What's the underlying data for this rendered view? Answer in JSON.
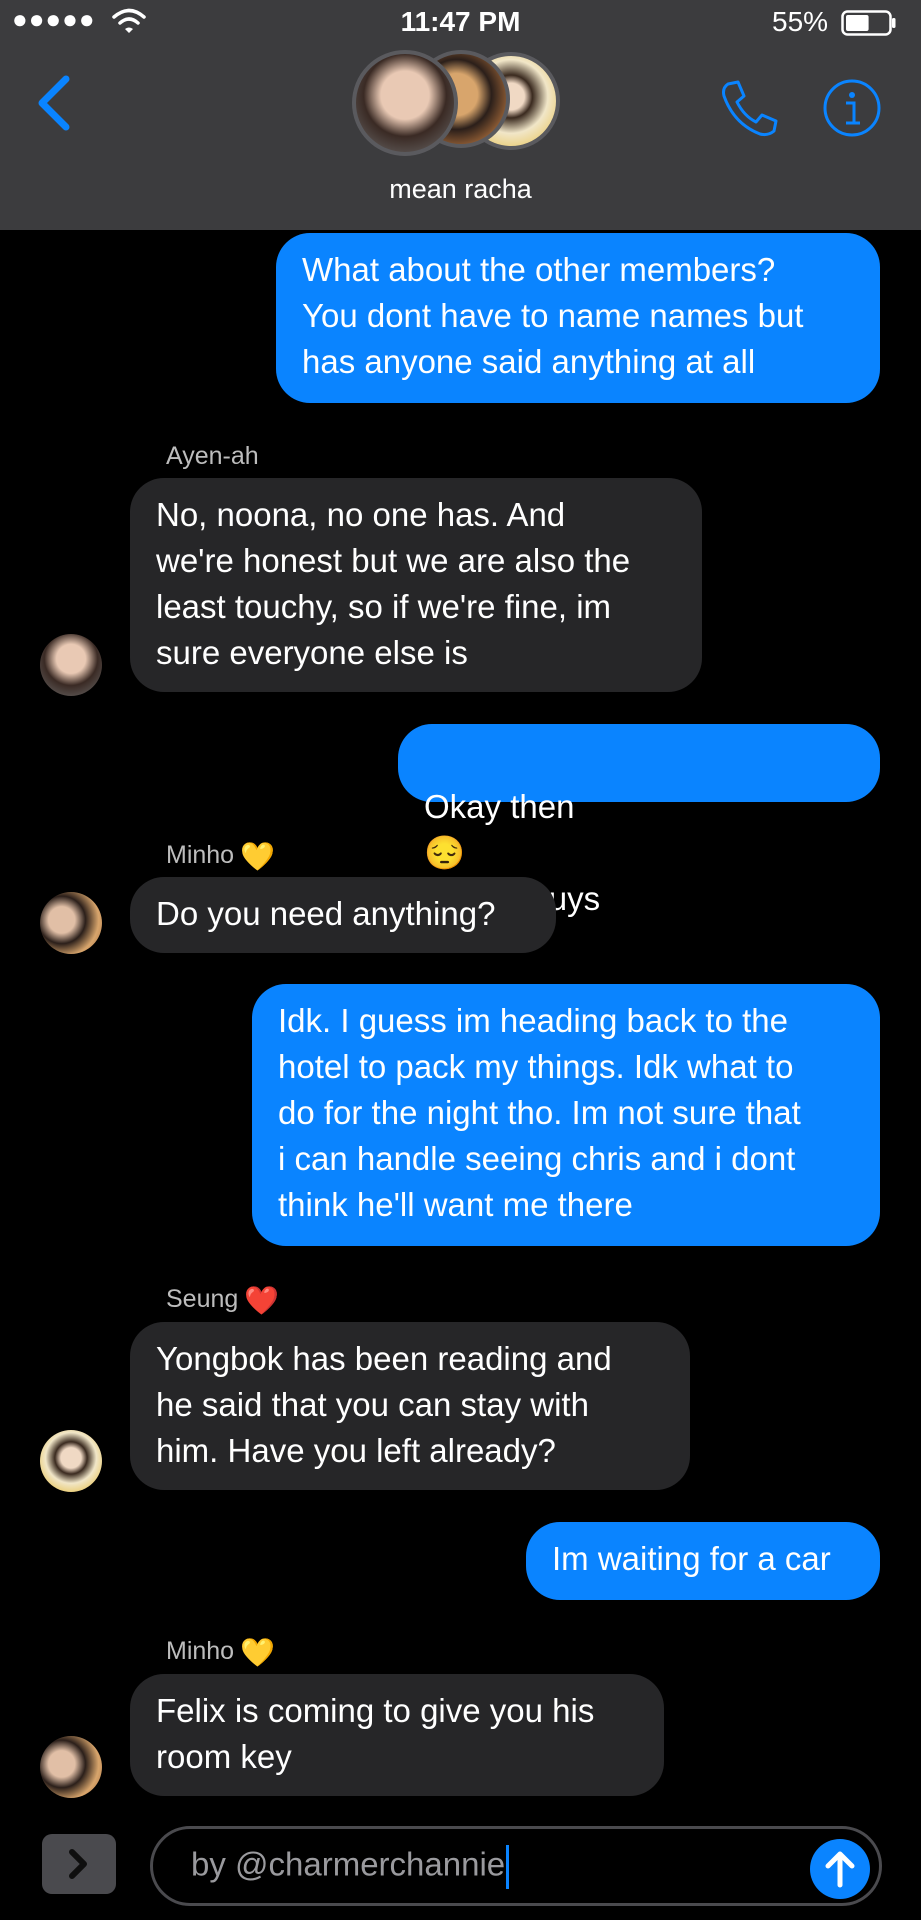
{
  "status_bar": {
    "signal": "●●●●●",
    "time": "11:47 PM",
    "battery": "55%",
    "battery_level": 0.55
  },
  "header": {
    "group_name": "mean racha",
    "icons": [
      "back-chevron-icon",
      "phone-icon",
      "info-icon"
    ]
  },
  "messages": [
    {
      "dir": "out",
      "text": "What about the other members?\nYou dont have to name names but\nhas anyone said anything at all"
    },
    {
      "dir": "in",
      "sender": "Ayen-ah",
      "text": "No, noona, no one has. And\nwe're honest but we are also the\nleast touchy, so if we're fine, im\nsure everyone else is"
    },
    {
      "dir": "out",
      "text_before": "Okay then",
      "emoji": "😔",
      "text_after": "thanks guys"
    },
    {
      "dir": "in",
      "sender": "Minho",
      "sender_emoji": "💛",
      "text": "Do you need anything?"
    },
    {
      "dir": "out",
      "text": "Idk. I guess im heading back to the\nhotel to pack my things. Idk what to\ndo for the night tho. Im not sure that\ni can handle seeing chris and i dont\nthink he'll want me there"
    },
    {
      "dir": "in",
      "sender": "Seung",
      "sender_emoji": "❤️",
      "text": "Yongbok has been reading and\nhe said that you can stay with\nhim. Have you left already?"
    },
    {
      "dir": "out",
      "text": "Im waiting for a car"
    },
    {
      "dir": "in",
      "sender": "Minho",
      "sender_emoji": "💛",
      "text": "Felix is coming to give you his\nroom key"
    }
  ],
  "compose": {
    "text": "by @charmerchannie"
  },
  "colors": {
    "outgoing": "#0a84ff",
    "incoming": "#262628",
    "header": "#3c3c3e",
    "background": "#000000"
  }
}
